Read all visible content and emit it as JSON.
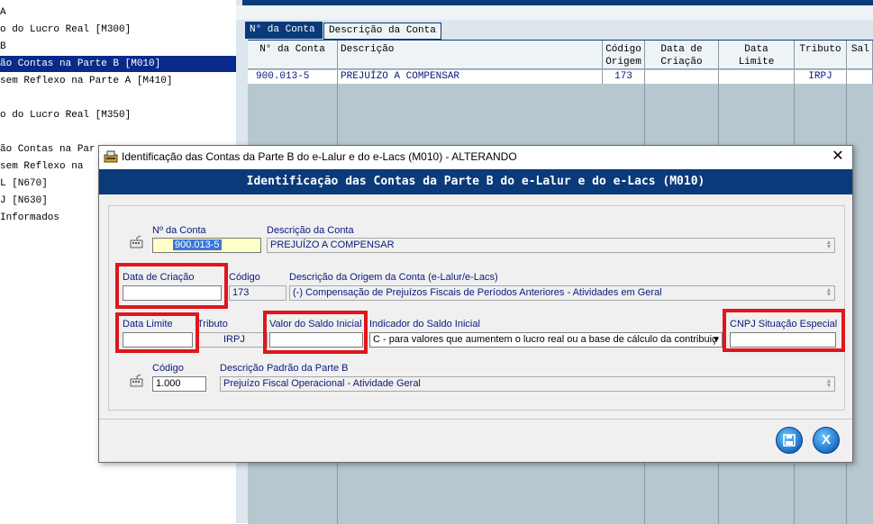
{
  "tree": {
    "items": [
      {
        "label": "A",
        "selected": false
      },
      {
        "label": "o do Lucro Real [M300]",
        "selected": false
      },
      {
        "label": "B",
        "selected": false
      },
      {
        "label": "ão Contas na Parte B [M010]",
        "selected": true
      },
      {
        "label": " sem Reflexo na Parte A [M410]",
        "selected": false
      },
      {
        "label": "",
        "selected": false
      },
      {
        "label": "o do Lucro Real [M350]",
        "selected": false
      },
      {
        "label": "",
        "selected": false
      },
      {
        "label": "ão Contas na Par",
        "selected": false
      },
      {
        "label": " sem Reflexo na",
        "selected": false
      },
      {
        "label": "J [N630]",
        "selected": false
      },
      {
        "label": "L [N670]",
        "selected": false
      },
      {
        "label": " Informados",
        "selected": false
      }
    ]
  },
  "tabs": {
    "conta": "N° da Conta",
    "descricao": "Descrição da Conta"
  },
  "grid": {
    "headers": {
      "conta": "N° da Conta",
      "descricao": "Descrição",
      "codigo_origem": "Código\nOrigem",
      "data_criacao": "Data de\nCriação",
      "data_limite": "Data\nLimite",
      "tributo": "Tributo",
      "saldo": "Sal"
    },
    "rows": [
      {
        "conta": "900.013-5",
        "descricao": "PREJUÍZO A COMPENSAR",
        "codigo_origem": "173",
        "data_criacao": "",
        "data_limite": "",
        "tributo": "IRPJ",
        "saldo": ""
      }
    ]
  },
  "dialog": {
    "title": "Identificação das Contas da Parte B do e-Lalur e do e-Lacs (M010)  -  ALTERANDO",
    "close": "✕",
    "header": "Identificação das Contas da Parte B do e-Lalur e do e-Lacs (M010)",
    "fields": {
      "conta_label": "Nº da Conta",
      "conta_value": "900.013-5",
      "desc_label": "Descrição da Conta",
      "desc_value": "PREJUÍZO A COMPENSAR",
      "data_criacao_label": "Data de Criação",
      "data_criacao_value": "",
      "codigo_label": "Código",
      "codigo_value": "173",
      "desc_origem_label": "Descrição da Origem da Conta (e-Lalur/e-Lacs)",
      "desc_origem_value": "(-) Compensação de Prejuízos Fiscais de Períodos Anteriores - Atividades em Geral",
      "data_limite_label": "Data Limite",
      "data_limite_value": "",
      "tributo_label": "Tributo",
      "tributo_value": "IRPJ",
      "valor_saldo_label": "Valor do Saldo Inicial",
      "valor_saldo_value": "",
      "indicador_label": "Indicador do Saldo Inicial",
      "indicador_value": "C - para valores que aumentem o lucro real ou a base de cálculo da contribuiç",
      "cnpj_label": "CNPJ Situação Especial",
      "cnpj_value": "",
      "codigo2_label": "Código",
      "codigo2_value": "1.000",
      "desc_padrao_label": "Descrição Padrão da Parte B",
      "desc_padrao_value": "Prejuízo Fiscal Operacional - Atividade Geral"
    }
  },
  "colors": {
    "navy": "#0a3a7a",
    "highlight_red": "#e0161c",
    "grid_bg": "#b6c7d0"
  }
}
